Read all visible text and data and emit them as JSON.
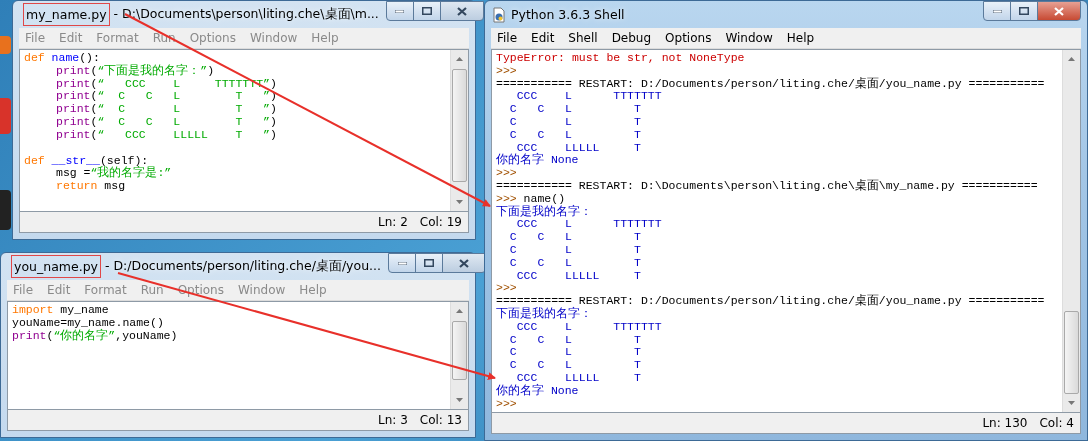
{
  "editor_windows": [
    {
      "file_name": "my_name.py",
      "path": "- D:\\Documents\\person\\liting.che\\桌面\\m...",
      "active": false,
      "menu": [
        "File",
        "Edit",
        "Format",
        "Run",
        "Options",
        "Window",
        "Help"
      ],
      "code": [
        {
          "segments": [
            {
              "kind": "keyword",
              "text": "def"
            },
            {
              "kind": "defname",
              "text": "name"
            },
            {
              "kind": "plain",
              "text": "():"
            }
          ],
          "children": [
            {
              "segments": [
                {
                  "kind": "builtin",
                  "text": "print"
                },
                {
                  "kind": "plain",
                  "text": "("
                },
                {
                  "kind": "string",
                  "text": "“下面是我的名字：”"
                },
                {
                  "kind": "plain",
                  "text": ")"
                }
              ]
            },
            {
              "segments": [
                {
                  "kind": "builtin",
                  "text": "print"
                },
                {
                  "kind": "plain",
                  "text": "("
                },
                {
                  "kind": "string",
                  "text": "“   CCC    L     TTTTTTT”"
                },
                {
                  "kind": "plain",
                  "text": ")"
                }
              ]
            },
            {
              "segments": [
                {
                  "kind": "builtin",
                  "text": "print"
                },
                {
                  "kind": "plain",
                  "text": "("
                },
                {
                  "kind": "string",
                  "text": "“  C   C   L        T   ”"
                },
                {
                  "kind": "plain",
                  "text": ")"
                }
              ]
            },
            {
              "segments": [
                {
                  "kind": "builtin",
                  "text": "print"
                },
                {
                  "kind": "plain",
                  "text": "("
                },
                {
                  "kind": "string",
                  "text": "“  C       L        T   ”"
                },
                {
                  "kind": "plain",
                  "text": ")"
                }
              ]
            },
            {
              "segments": [
                {
                  "kind": "builtin",
                  "text": "print"
                },
                {
                  "kind": "plain",
                  "text": "("
                },
                {
                  "kind": "string",
                  "text": "“  C   C   L        T   ”"
                },
                {
                  "kind": "plain",
                  "text": ")"
                }
              ]
            },
            {
              "segments": [
                {
                  "kind": "builtin",
                  "text": "print"
                },
                {
                  "kind": "plain",
                  "text": "("
                },
                {
                  "kind": "string",
                  "text": "“   CCC    LLLLL    T   ”"
                },
                {
                  "kind": "plain",
                  "text": ")"
                }
              ]
            }
          ]
        },
        {
          "segments": [
            {
              "kind": "keyword",
              "text": "def"
            },
            {
              "kind": "defname",
              "text": "__str__"
            },
            {
              "kind": "plain",
              "text": "(self):"
            }
          ],
          "children": [
            {
              "segments": [
                {
                  "kind": "plain",
                  "text": "msg ="
                },
                {
                  "kind": "string",
                  "text": "“我的名字是:”"
                }
              ]
            },
            {
              "segments": [
                {
                  "kind": "keyword",
                  "text": "return"
                },
                {
                  "kind": "plain",
                  "text": " msg"
                }
              ]
            }
          ]
        }
      ],
      "line": "Ln: 2",
      "column": "Col: 19"
    },
    {
      "file_name": "you_name.py",
      "path": "- D:/Documents/person/liting.che/桌面/you...",
      "active": false,
      "menu": [
        "File",
        "Edit",
        "Format",
        "Run",
        "Options",
        "Window",
        "Help"
      ],
      "code": [
        {
          "segments": [
            {
              "kind": "keyword",
              "text": "import"
            },
            {
              "kind": "plain",
              "text": " my_name"
            }
          ]
        },
        {
          "segments": [
            {
              "kind": "plain",
              "text": "youName=my_name.name()"
            }
          ]
        },
        {
          "segments": [
            {
              "kind": "builtin",
              "text": "print"
            },
            {
              "kind": "plain",
              "text": "("
            },
            {
              "kind": "string",
              "text": "“你的名字”"
            },
            {
              "kind": "plain",
              "text": ",youName)"
            }
          ]
        }
      ],
      "line": "Ln: 3",
      "column": "Col: 13"
    }
  ],
  "shell_window": {
    "title": "Python 3.6.3 Shell",
    "active": true,
    "menu": [
      "File",
      "Edit",
      "Shell",
      "Debug",
      "Options",
      "Window",
      "Help"
    ],
    "lines": [
      {
        "kind": "error",
        "text": "TypeError: must be str, not NoneType"
      },
      {
        "kind": "prompt",
        "text": ">>>"
      },
      {
        "kind": "restart",
        "text": "=========== RESTART: D:/Documents/person/liting.che/桌面/you_name.py ==========="
      },
      {
        "kind": "output",
        "text": "   CCC    L      TTTTTTT"
      },
      {
        "kind": "output",
        "text": "  C   C   L         T"
      },
      {
        "kind": "output",
        "text": "  C       L         T"
      },
      {
        "kind": "output",
        "text": "  C   C   L         T"
      },
      {
        "kind": "output",
        "text": "   CCC    LLLLL     T"
      },
      {
        "kind": "output",
        "text": "你的名字 None"
      },
      {
        "kind": "prompt",
        "text": ">>>"
      },
      {
        "kind": "restart",
        "text": "=========== RESTART: D:\\Documents\\person\\liting.che\\桌面\\my_name.py ==========="
      },
      {
        "kind": "prompt",
        "text": ">>>",
        "input": "name()"
      },
      {
        "kind": "output",
        "text": "下面是我的名字："
      },
      {
        "kind": "output",
        "text": "   CCC    L      TTTTTTT"
      },
      {
        "kind": "output",
        "text": "  C   C   L         T"
      },
      {
        "kind": "output",
        "text": "  C       L         T"
      },
      {
        "kind": "output",
        "text": "  C   C   L         T"
      },
      {
        "kind": "output",
        "text": "   CCC    LLLLL     T"
      },
      {
        "kind": "prompt",
        "text": ">>>"
      },
      {
        "kind": "restart",
        "text": "=========== RESTART: D:/Documents/person/liting.che/桌面/you_name.py ==========="
      },
      {
        "kind": "output",
        "text": "下面是我的名字："
      },
      {
        "kind": "output",
        "text": "   CCC    L      TTTTTTT"
      },
      {
        "kind": "output",
        "text": "  C   C   L         T"
      },
      {
        "kind": "output",
        "text": "  C       L         T"
      },
      {
        "kind": "output",
        "text": "  C   C   L         T"
      },
      {
        "kind": "output",
        "text": "   CCC    LLLLL     T"
      },
      {
        "kind": "output",
        "text": "你的名字 None"
      },
      {
        "kind": "prompt",
        "text": ">>>"
      }
    ],
    "line": "Ln: 130",
    "column": "Col: 4"
  }
}
